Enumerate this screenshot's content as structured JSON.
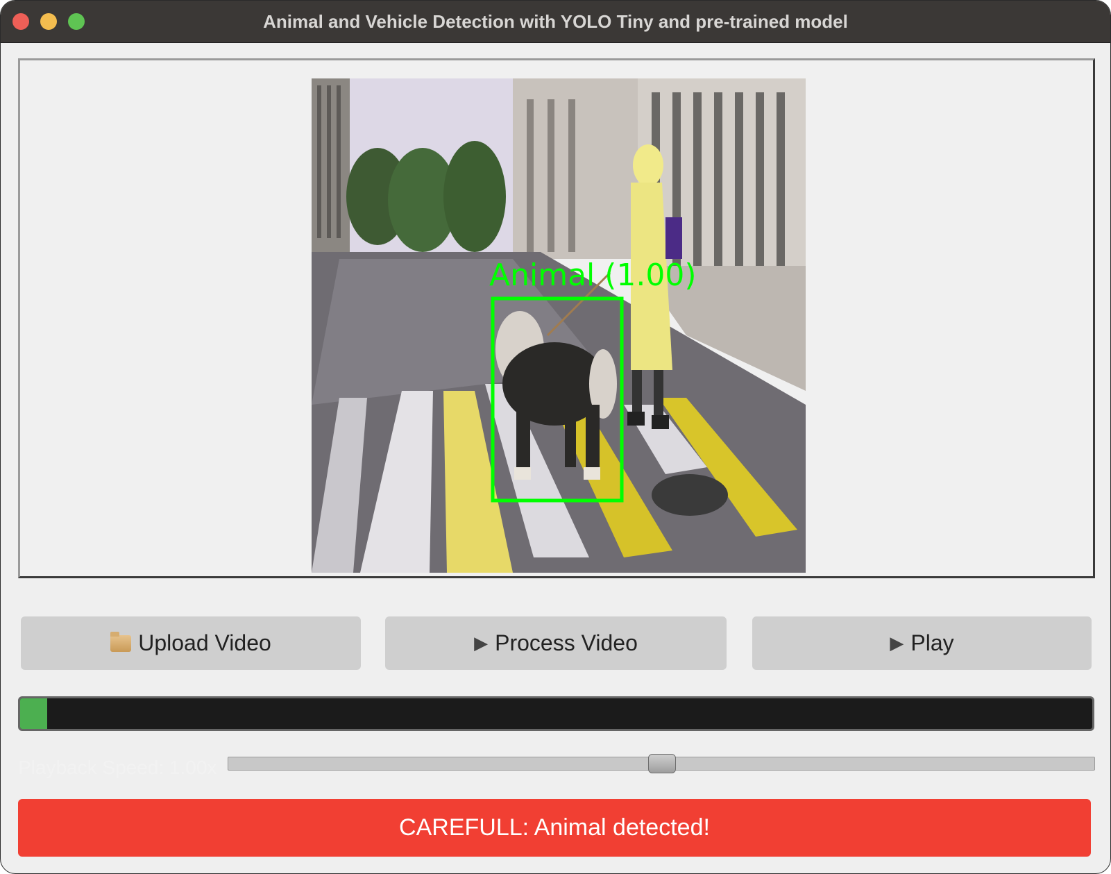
{
  "window": {
    "title": "Animal and Vehicle Detection with YOLO Tiny and pre-trained model"
  },
  "video": {
    "detection_label": "Animal (1.00)",
    "box_color": "#00ff00"
  },
  "buttons": {
    "upload": {
      "label": "Upload Video",
      "icon": "folder-icon"
    },
    "process": {
      "label": "Process Video",
      "icon": "play-triangle-icon"
    },
    "play": {
      "label": "Play",
      "icon": "play-triangle-icon"
    }
  },
  "progress": {
    "fraction": 0.025,
    "fill_color": "#4caf50"
  },
  "playback": {
    "label": "Playback Speed: 1.00x",
    "slider_fraction": 0.5
  },
  "alert": {
    "text": "CAREFULL: Animal detected!",
    "color": "#f13f33"
  }
}
